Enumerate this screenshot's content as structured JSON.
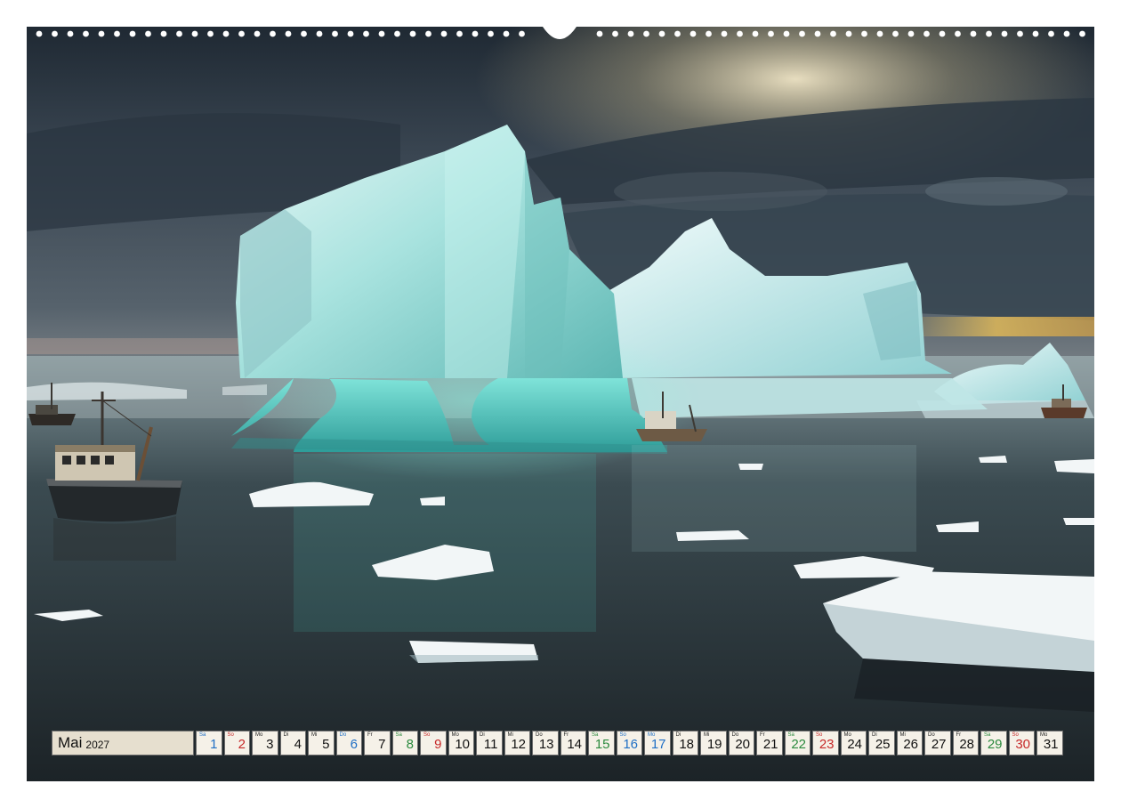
{
  "calendar": {
    "month": "Mai",
    "year": "2027",
    "days": [
      {
        "wd": "Sa",
        "n": "1",
        "type": "hol"
      },
      {
        "wd": "So",
        "n": "2",
        "type": "sun"
      },
      {
        "wd": "Mo",
        "n": "3",
        "type": "wd"
      },
      {
        "wd": "Di",
        "n": "4",
        "type": "wd"
      },
      {
        "wd": "Mi",
        "n": "5",
        "type": "wd"
      },
      {
        "wd": "Do",
        "n": "6",
        "type": "hol"
      },
      {
        "wd": "Fr",
        "n": "7",
        "type": "wd"
      },
      {
        "wd": "Sa",
        "n": "8",
        "type": "sat"
      },
      {
        "wd": "So",
        "n": "9",
        "type": "sun"
      },
      {
        "wd": "Mo",
        "n": "10",
        "type": "wd"
      },
      {
        "wd": "Di",
        "n": "11",
        "type": "wd"
      },
      {
        "wd": "Mi",
        "n": "12",
        "type": "wd"
      },
      {
        "wd": "Do",
        "n": "13",
        "type": "wd"
      },
      {
        "wd": "Fr",
        "n": "14",
        "type": "wd"
      },
      {
        "wd": "Sa",
        "n": "15",
        "type": "sat"
      },
      {
        "wd": "So",
        "n": "16",
        "type": "hol"
      },
      {
        "wd": "Mo",
        "n": "17",
        "type": "hol"
      },
      {
        "wd": "Di",
        "n": "18",
        "type": "wd"
      },
      {
        "wd": "Mi",
        "n": "19",
        "type": "wd"
      },
      {
        "wd": "Do",
        "n": "20",
        "type": "wd"
      },
      {
        "wd": "Fr",
        "n": "21",
        "type": "wd"
      },
      {
        "wd": "Sa",
        "n": "22",
        "type": "sat"
      },
      {
        "wd": "So",
        "n": "23",
        "type": "sun"
      },
      {
        "wd": "Mo",
        "n": "24",
        "type": "wd"
      },
      {
        "wd": "Di",
        "n": "25",
        "type": "wd"
      },
      {
        "wd": "Mi",
        "n": "26",
        "type": "wd"
      },
      {
        "wd": "Do",
        "n": "27",
        "type": "wd"
      },
      {
        "wd": "Fr",
        "n": "28",
        "type": "wd"
      },
      {
        "wd": "Sa",
        "n": "29",
        "type": "sat"
      },
      {
        "wd": "So",
        "n": "30",
        "type": "sun"
      },
      {
        "wd": "Mo",
        "n": "31",
        "type": "wd"
      }
    ]
  },
  "colors": {
    "weekday": "#111111",
    "saturday": "#2b8a3e",
    "sunday": "#c62828",
    "holiday": "#1f6fc5",
    "cell_bg": "#f5f1e8",
    "month_bg": "#e6dfcf"
  }
}
